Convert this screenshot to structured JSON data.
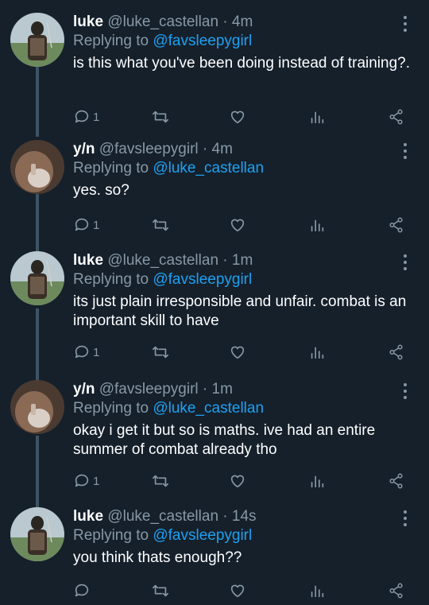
{
  "thread": [
    {
      "name": "luke",
      "handle": "@luke_castellan",
      "time": "4m",
      "replying_prefix": "Replying to ",
      "replying_to": "@favsleepygirl",
      "text": "is this what you've been doing instead of training?.",
      "reply_count": "1",
      "avatar": "luke-avatar"
    },
    {
      "name": "y/n",
      "handle": "@favsleepygirl",
      "time": "4m",
      "replying_prefix": "Replying to ",
      "replying_to": "@luke_castellan",
      "text": "yes. so?",
      "reply_count": "1",
      "avatar": "yn-avatar"
    },
    {
      "name": "luke",
      "handle": "@luke_castellan",
      "time": "1m",
      "replying_prefix": "Replying to ",
      "replying_to": "@favsleepygirl",
      "text": "its just plain irresponsible and unfair. combat is an important skill to have",
      "reply_count": "1",
      "avatar": "luke-avatar"
    },
    {
      "name": "y/n",
      "handle": "@favsleepygirl",
      "time": "1m",
      "replying_prefix": "Replying to ",
      "replying_to": "@luke_castellan",
      "text": "okay i get it but so is maths. ive had an entire summer of combat already tho",
      "reply_count": "1",
      "avatar": "yn-avatar"
    },
    {
      "name": "luke",
      "handle": "@luke_castellan",
      "time": "14s",
      "replying_prefix": "Replying to ",
      "replying_to": "@favsleepygirl",
      "text": "you think thats enough??",
      "reply_count": "",
      "avatar": "luke-avatar"
    }
  ],
  "separator": " · ",
  "colors": {
    "background": "#15202b",
    "secondary_text": "#8899a6",
    "mention": "#1da1f2",
    "thread_line": "#3d5466"
  },
  "icons": [
    "more-icon",
    "reply-icon",
    "retweet-icon",
    "like-icon",
    "stats-icon",
    "share-icon"
  ]
}
